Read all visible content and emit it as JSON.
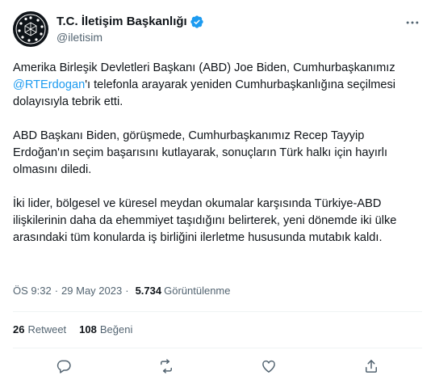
{
  "author": {
    "display_name": "T.C. İletişim Başkanlığı",
    "handle": "@iletisim",
    "verified": true
  },
  "tweet": {
    "paragraph1_before": "Amerika Birleşik Devletleri Başkanı (ABD) Joe Biden, Cumhurbaşkanımız ",
    "mention": "@RTErdogan",
    "paragraph1_after": "'ı telefonla arayarak yeniden Cumhurbaşkanlığına seçilmesi dolayısıyla tebrik etti.",
    "paragraph2": "ABD Başkanı Biden, görüşmede, Cumhurbaşkanımız Recep Tayyip Erdoğan'ın seçim başarısını kutlayarak, sonuçların Türk halkı için hayırlı olmasını diledi.",
    "paragraph3": "İki lider, bölgesel ve küresel meydan okumalar karşısında Türkiye-ABD ilişkilerinin daha da ehemmiyet taşıdığını belirterek, yeni dönemde iki ülke arasındaki tüm konularda iş birliğini ilerletme hususunda mutabık kaldı."
  },
  "meta": {
    "time": "ÖS 9:32",
    "separator": "·",
    "date": "29 May 2023",
    "views": "5.734",
    "views_label": "Görüntülenme"
  },
  "stats": {
    "retweets": "26",
    "retweets_label": "Retweet",
    "likes": "108",
    "likes_label": "Beğeni"
  },
  "icons": {
    "avatar": "government-seal-icon",
    "verified": "verified-badge-icon",
    "more": "more-icon",
    "reply": "reply-icon",
    "retweet": "retweet-icon",
    "like": "like-icon",
    "share": "share-icon"
  },
  "colors": {
    "accent": "#1d9bf0",
    "text": "#0f1419",
    "secondary": "#536471",
    "divider": "#eff3f4"
  }
}
